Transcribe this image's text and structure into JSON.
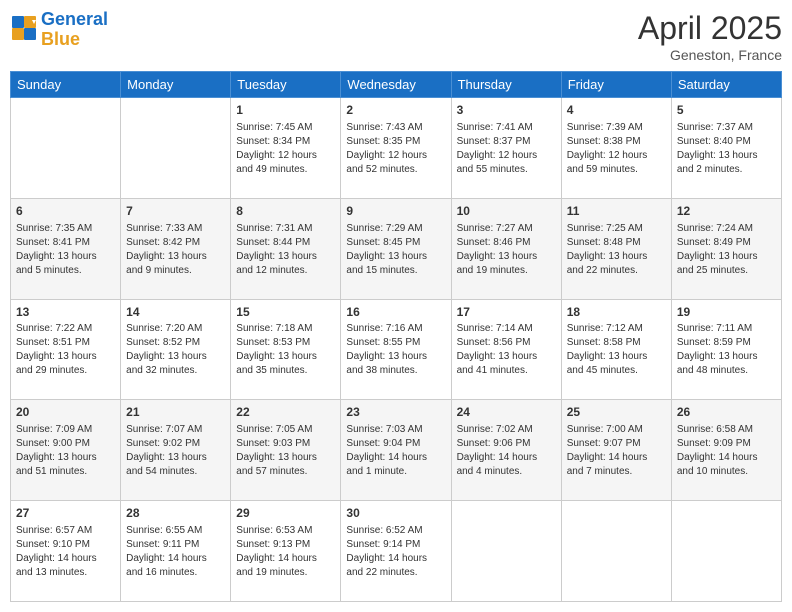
{
  "header": {
    "logo_line1": "General",
    "logo_line2": "Blue",
    "month_title": "April 2025",
    "location": "Geneston, France"
  },
  "days_of_week": [
    "Sunday",
    "Monday",
    "Tuesday",
    "Wednesday",
    "Thursday",
    "Friday",
    "Saturday"
  ],
  "weeks": [
    [
      {
        "day": "",
        "sunrise": "",
        "sunset": "",
        "daylight": ""
      },
      {
        "day": "",
        "sunrise": "",
        "sunset": "",
        "daylight": ""
      },
      {
        "day": "1",
        "sunrise": "Sunrise: 7:45 AM",
        "sunset": "Sunset: 8:34 PM",
        "daylight": "Daylight: 12 hours and 49 minutes."
      },
      {
        "day": "2",
        "sunrise": "Sunrise: 7:43 AM",
        "sunset": "Sunset: 8:35 PM",
        "daylight": "Daylight: 12 hours and 52 minutes."
      },
      {
        "day": "3",
        "sunrise": "Sunrise: 7:41 AM",
        "sunset": "Sunset: 8:37 PM",
        "daylight": "Daylight: 12 hours and 55 minutes."
      },
      {
        "day": "4",
        "sunrise": "Sunrise: 7:39 AM",
        "sunset": "Sunset: 8:38 PM",
        "daylight": "Daylight: 12 hours and 59 minutes."
      },
      {
        "day": "5",
        "sunrise": "Sunrise: 7:37 AM",
        "sunset": "Sunset: 8:40 PM",
        "daylight": "Daylight: 13 hours and 2 minutes."
      }
    ],
    [
      {
        "day": "6",
        "sunrise": "Sunrise: 7:35 AM",
        "sunset": "Sunset: 8:41 PM",
        "daylight": "Daylight: 13 hours and 5 minutes."
      },
      {
        "day": "7",
        "sunrise": "Sunrise: 7:33 AM",
        "sunset": "Sunset: 8:42 PM",
        "daylight": "Daylight: 13 hours and 9 minutes."
      },
      {
        "day": "8",
        "sunrise": "Sunrise: 7:31 AM",
        "sunset": "Sunset: 8:44 PM",
        "daylight": "Daylight: 13 hours and 12 minutes."
      },
      {
        "day": "9",
        "sunrise": "Sunrise: 7:29 AM",
        "sunset": "Sunset: 8:45 PM",
        "daylight": "Daylight: 13 hours and 15 minutes."
      },
      {
        "day": "10",
        "sunrise": "Sunrise: 7:27 AM",
        "sunset": "Sunset: 8:46 PM",
        "daylight": "Daylight: 13 hours and 19 minutes."
      },
      {
        "day": "11",
        "sunrise": "Sunrise: 7:25 AM",
        "sunset": "Sunset: 8:48 PM",
        "daylight": "Daylight: 13 hours and 22 minutes."
      },
      {
        "day": "12",
        "sunrise": "Sunrise: 7:24 AM",
        "sunset": "Sunset: 8:49 PM",
        "daylight": "Daylight: 13 hours and 25 minutes."
      }
    ],
    [
      {
        "day": "13",
        "sunrise": "Sunrise: 7:22 AM",
        "sunset": "Sunset: 8:51 PM",
        "daylight": "Daylight: 13 hours and 29 minutes."
      },
      {
        "day": "14",
        "sunrise": "Sunrise: 7:20 AM",
        "sunset": "Sunset: 8:52 PM",
        "daylight": "Daylight: 13 hours and 32 minutes."
      },
      {
        "day": "15",
        "sunrise": "Sunrise: 7:18 AM",
        "sunset": "Sunset: 8:53 PM",
        "daylight": "Daylight: 13 hours and 35 minutes."
      },
      {
        "day": "16",
        "sunrise": "Sunrise: 7:16 AM",
        "sunset": "Sunset: 8:55 PM",
        "daylight": "Daylight: 13 hours and 38 minutes."
      },
      {
        "day": "17",
        "sunrise": "Sunrise: 7:14 AM",
        "sunset": "Sunset: 8:56 PM",
        "daylight": "Daylight: 13 hours and 41 minutes."
      },
      {
        "day": "18",
        "sunrise": "Sunrise: 7:12 AM",
        "sunset": "Sunset: 8:58 PM",
        "daylight": "Daylight: 13 hours and 45 minutes."
      },
      {
        "day": "19",
        "sunrise": "Sunrise: 7:11 AM",
        "sunset": "Sunset: 8:59 PM",
        "daylight": "Daylight: 13 hours and 48 minutes."
      }
    ],
    [
      {
        "day": "20",
        "sunrise": "Sunrise: 7:09 AM",
        "sunset": "Sunset: 9:00 PM",
        "daylight": "Daylight: 13 hours and 51 minutes."
      },
      {
        "day": "21",
        "sunrise": "Sunrise: 7:07 AM",
        "sunset": "Sunset: 9:02 PM",
        "daylight": "Daylight: 13 hours and 54 minutes."
      },
      {
        "day": "22",
        "sunrise": "Sunrise: 7:05 AM",
        "sunset": "Sunset: 9:03 PM",
        "daylight": "Daylight: 13 hours and 57 minutes."
      },
      {
        "day": "23",
        "sunrise": "Sunrise: 7:03 AM",
        "sunset": "Sunset: 9:04 PM",
        "daylight": "Daylight: 14 hours and 1 minute."
      },
      {
        "day": "24",
        "sunrise": "Sunrise: 7:02 AM",
        "sunset": "Sunset: 9:06 PM",
        "daylight": "Daylight: 14 hours and 4 minutes."
      },
      {
        "day": "25",
        "sunrise": "Sunrise: 7:00 AM",
        "sunset": "Sunset: 9:07 PM",
        "daylight": "Daylight: 14 hours and 7 minutes."
      },
      {
        "day": "26",
        "sunrise": "Sunrise: 6:58 AM",
        "sunset": "Sunset: 9:09 PM",
        "daylight": "Daylight: 14 hours and 10 minutes."
      }
    ],
    [
      {
        "day": "27",
        "sunrise": "Sunrise: 6:57 AM",
        "sunset": "Sunset: 9:10 PM",
        "daylight": "Daylight: 14 hours and 13 minutes."
      },
      {
        "day": "28",
        "sunrise": "Sunrise: 6:55 AM",
        "sunset": "Sunset: 9:11 PM",
        "daylight": "Daylight: 14 hours and 16 minutes."
      },
      {
        "day": "29",
        "sunrise": "Sunrise: 6:53 AM",
        "sunset": "Sunset: 9:13 PM",
        "daylight": "Daylight: 14 hours and 19 minutes."
      },
      {
        "day": "30",
        "sunrise": "Sunrise: 6:52 AM",
        "sunset": "Sunset: 9:14 PM",
        "daylight": "Daylight: 14 hours and 22 minutes."
      },
      {
        "day": "",
        "sunrise": "",
        "sunset": "",
        "daylight": ""
      },
      {
        "day": "",
        "sunrise": "",
        "sunset": "",
        "daylight": ""
      },
      {
        "day": "",
        "sunrise": "",
        "sunset": "",
        "daylight": ""
      }
    ]
  ]
}
